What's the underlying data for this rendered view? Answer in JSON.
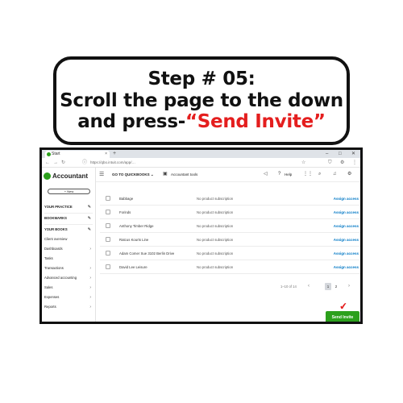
{
  "instruction": {
    "line1": "Step # 05:",
    "line2": "Scroll the page to the down",
    "line3_prefix": "and press-",
    "line3_highlight": "“Send Invite”"
  },
  "browser": {
    "tab_title": "Start",
    "url": "https://qbo.intuit.com/app/…",
    "tab_close": "×",
    "tab_plus": "+"
  },
  "sidebar": {
    "brand": "Accountant",
    "new_button": "+ New",
    "items": [
      {
        "label": "YOUR PRACTICE",
        "bold": true
      },
      {
        "label": "BOOKMARKS",
        "bold": true
      },
      {
        "label": "YOUR BOOKS",
        "bold": true
      },
      {
        "label": "Client overview"
      },
      {
        "label": "Dashboards"
      },
      {
        "label": "Tasks"
      },
      {
        "label": "Transactions"
      },
      {
        "label": "Advanced accounting"
      },
      {
        "label": "Sales"
      },
      {
        "label": "Expenses"
      },
      {
        "label": "Reports"
      }
    ]
  },
  "header": {
    "go_to": "GO TO QUICKBOOKS ⌄",
    "accountant_tools": "Accountant tools",
    "help": "Help"
  },
  "table": {
    "rows": [
      {
        "name": "Babbage",
        "subscription": "No product subscription",
        "action": "Assign access"
      },
      {
        "name": "Forinds",
        "subscription": "No product subscription",
        "action": "Assign access"
      },
      {
        "name": "Anthony Timber Ridge",
        "subscription": "No product subscription",
        "action": "Assign access"
      },
      {
        "name": "Ratcus Kourts Line",
        "subscription": "No product subscription",
        "action": "Assign access"
      },
      {
        "name": "Adam Comer Sue 3102 Berlin Drive",
        "subscription": "No product subscription",
        "action": "Assign access"
      },
      {
        "name": "David Lee Leisure",
        "subscription": "No product subscription",
        "action": "Assign access"
      }
    ]
  },
  "pagination": {
    "range": "1–10 of 14",
    "pages": [
      "1",
      "2"
    ],
    "current": "1",
    "prev": "‹",
    "next": "›"
  },
  "send_button": "Send Invite",
  "colors": {
    "brand_green": "#2ca01c",
    "link_blue": "#0077c5",
    "highlight_red": "#e41e1e"
  }
}
